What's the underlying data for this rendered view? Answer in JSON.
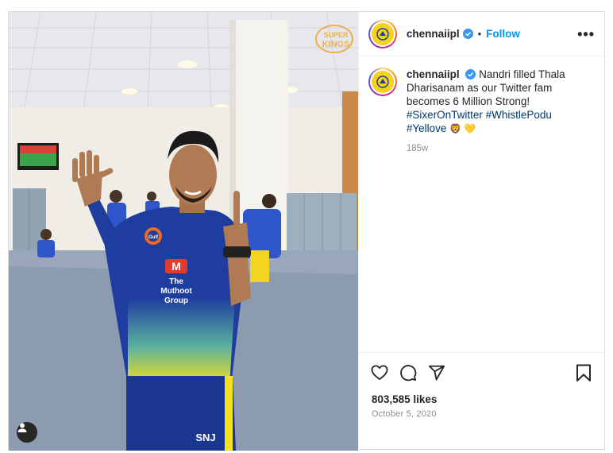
{
  "post": {
    "username": "chennaiipl",
    "follow_label": "Follow",
    "separator": "•",
    "more_label": "•••",
    "caption": {
      "username": "chennaiipl",
      "text": "Nandri filled Thala Dharisanam as our Twitter fam becomes 6 Million Strong!",
      "hashtags": [
        "#SixerOnTwitter",
        "#WhistlePodu",
        "#Yellove"
      ],
      "emojis": "🦁 💛",
      "age": "185w"
    },
    "likes": "803,585 likes",
    "date": "October 5, 2020"
  },
  "photo": {
    "jersey_sponsor_line1": "The",
    "jersey_sponsor_line2": "Muthoot",
    "jersey_sponsor_line3": "Group",
    "jersey_chest": "Gulf",
    "shorts_text": "SNJ",
    "watermark_line1": "SUPER",
    "watermark_line2": "KINGS"
  },
  "colors": {
    "follow": "#0095f6",
    "hashtag": "#00376b",
    "verified": "#3897f0",
    "jersey_blue": "#1f3d9e",
    "jersey_yellow": "#f4e21f"
  },
  "icons": {
    "heart": "heart-icon",
    "comment": "comment-icon",
    "share": "share-icon",
    "save": "bookmark-icon",
    "user_tag": "user-tag-icon",
    "verified": "verified-badge-icon",
    "more": "more-options-icon"
  }
}
